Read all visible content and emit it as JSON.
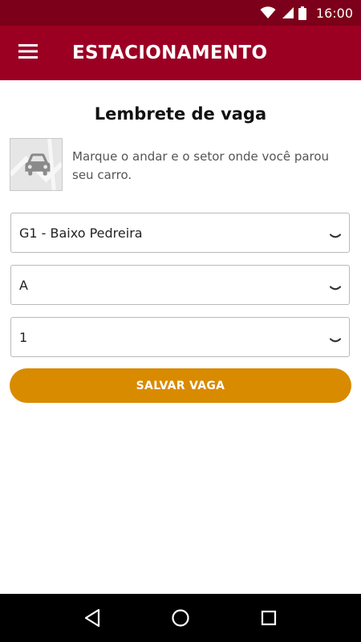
{
  "status_bar": {
    "time": "16:00"
  },
  "app_bar": {
    "title": "ESTACIONAMENTO",
    "menu_icon": "hamburger-menu-icon"
  },
  "main": {
    "title": "Lembrete de vaga",
    "hint": "Marque o andar e o setor onde você parou seu carro.",
    "thumb_icon": "car-map-icon",
    "selects": [
      {
        "value": "G1 - Baixo Pedreira"
      },
      {
        "value": "A"
      },
      {
        "value": "1"
      }
    ],
    "save_label": "SALVAR VAGA"
  },
  "colors": {
    "status_bar": "#7c0019",
    "app_bar": "#9b0023",
    "accent_button": "#d98b00"
  },
  "nav_bar": {
    "back_icon": "back-triangle-icon",
    "home_icon": "home-circle-icon",
    "recents_icon": "recents-square-icon"
  }
}
